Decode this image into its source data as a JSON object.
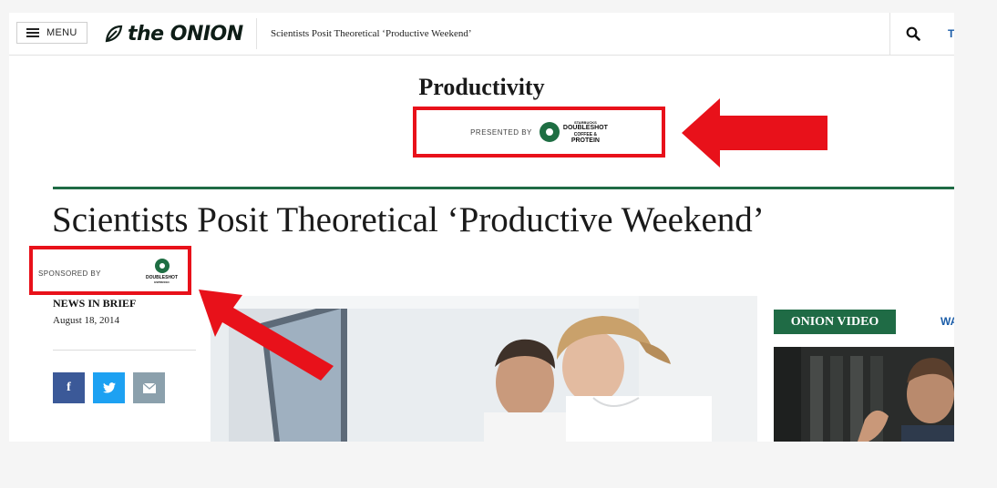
{
  "header": {
    "menu_label": "MENU",
    "logo_text": "the ONION",
    "article_title": "Scientists Posit Theoretical ‘Productive Weekend’",
    "right_link_fragment": "T"
  },
  "section": {
    "title": "Productivity",
    "presented_by_label": "PRESENTED BY",
    "sponsor_brand": [
      "STARBUCKS",
      "DOUBLESHOT",
      "COFFEE &",
      "PROTEIN"
    ]
  },
  "article": {
    "headline": "Scientists Posit Theoretical ‘Productive Weekend’",
    "sponsored_by_label": "SPONSORED BY",
    "sponsor_brand_small": [
      "DOUBLESHOT",
      "ESPRESSO"
    ],
    "kicker": "NEWS IN BRIEF",
    "date": "August 18, 2014"
  },
  "share": {
    "facebook_glyph": "f",
    "twitter_icon": "twitter-bird",
    "email_icon": "envelope"
  },
  "sidebar": {
    "video_label": "ONION VIDEO",
    "video_link_fragment": "WA"
  },
  "colors": {
    "onion_green": "#1f6b45",
    "annotation_red": "#e8111a",
    "facebook": "#3b5998",
    "twitter": "#1da1f2",
    "email": "#8ba0ac"
  }
}
